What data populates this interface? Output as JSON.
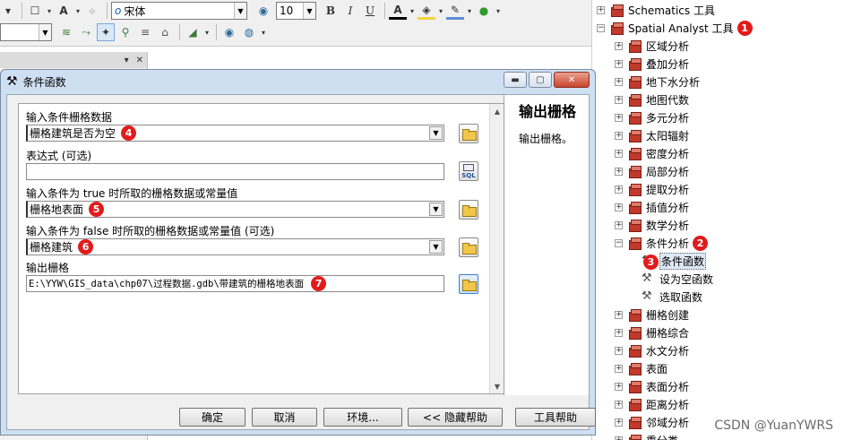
{
  "toolbar": {
    "font_name": "宋体",
    "font_size": "10",
    "bold": "B",
    "italic": "I",
    "underline": "U",
    "text_color_glyph": "A"
  },
  "dialog": {
    "title": "条件函数",
    "fields": [
      {
        "label": "输入条件栅格数据",
        "value": "栅格建筑是否为空",
        "badge": "4"
      },
      {
        "label": "表达式 (可选)",
        "value": ""
      },
      {
        "label": "输入条件为 true 时所取的栅格数据或常量值",
        "value": "栅格地表面",
        "badge": "5"
      },
      {
        "label": "输入条件为 false 时所取的栅格数据或常量值 (可选)",
        "value": "栅格建筑",
        "badge": "6"
      },
      {
        "label": "输出栅格",
        "value": "E:\\YYW\\GIS_data\\chp07\\过程数据.gdb\\带建筑的栅格地表面",
        "badge": "7"
      }
    ],
    "sql_label": "SQL",
    "help": {
      "title": "输出栅格",
      "body": "输出栅格。"
    },
    "buttons": {
      "ok": "确定",
      "cancel": "取消",
      "env": "环境...",
      "hide_help": "<< 隐藏帮助",
      "tool_help": "工具帮助"
    }
  },
  "tree": {
    "items": [
      {
        "label": "Schematics 工具",
        "level": 0,
        "expander": "+"
      },
      {
        "label": "Spatial Analyst 工具",
        "level": 0,
        "expander": "−",
        "badge": "1"
      },
      {
        "label": "区域分析",
        "level": 1,
        "expander": "+"
      },
      {
        "label": "叠加分析",
        "level": 1,
        "expander": "+"
      },
      {
        "label": "地下水分析",
        "level": 1,
        "expander": "+"
      },
      {
        "label": "地图代数",
        "level": 1,
        "expander": "+"
      },
      {
        "label": "多元分析",
        "level": 1,
        "expander": "+"
      },
      {
        "label": "太阳辐射",
        "level": 1,
        "expander": "+"
      },
      {
        "label": "密度分析",
        "level": 1,
        "expander": "+"
      },
      {
        "label": "局部分析",
        "level": 1,
        "expander": "+"
      },
      {
        "label": "提取分析",
        "level": 1,
        "expander": "+"
      },
      {
        "label": "插值分析",
        "level": 1,
        "expander": "+"
      },
      {
        "label": "数学分析",
        "level": 1,
        "expander": "+"
      },
      {
        "label": "条件分析",
        "level": 1,
        "expander": "−",
        "badge": "2"
      },
      {
        "label": "条件函数",
        "level": 2,
        "badge": "3"
      },
      {
        "label": "设为空函数",
        "level": 2
      },
      {
        "label": "选取函数",
        "level": 2
      },
      {
        "label": "栅格创建",
        "level": 1,
        "expander": "+"
      },
      {
        "label": "栅格综合",
        "level": 1,
        "expander": "+"
      },
      {
        "label": "水文分析",
        "level": 1,
        "expander": "+"
      },
      {
        "label": "表面",
        "level": 1,
        "expander": "+"
      },
      {
        "label": "表面分析",
        "level": 1,
        "expander": "+"
      },
      {
        "label": "距离分析",
        "level": 1,
        "expander": "+"
      },
      {
        "label": "邻域分析",
        "level": 1,
        "expander": "+"
      },
      {
        "label": "重分类",
        "level": 1,
        "expander": "+"
      }
    ]
  },
  "watermark": "CSDN @YuanYWRS",
  "colors": {
    "badge": "#e21b1b",
    "dialog_frame": "#cfdff2",
    "toolbox": "#c0392b"
  }
}
